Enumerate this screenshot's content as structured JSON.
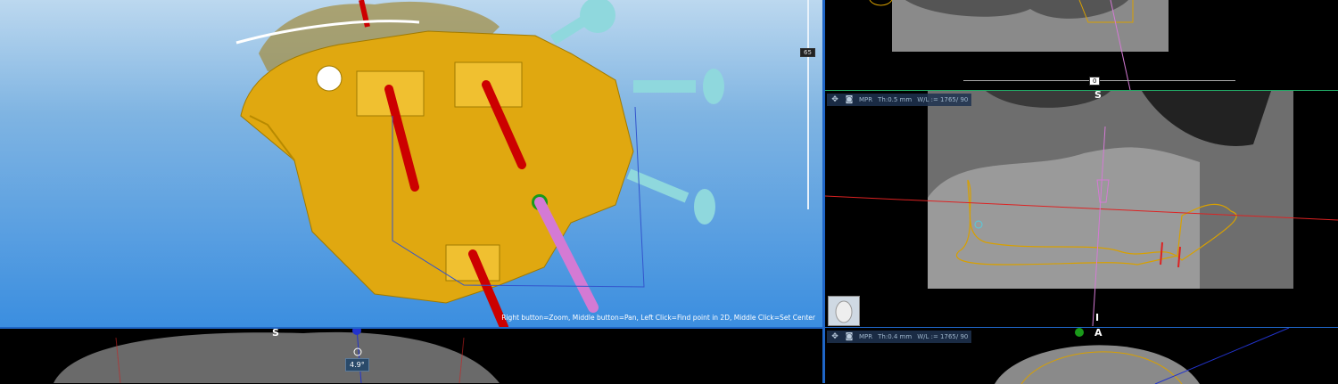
{
  "view3d": {
    "help_text": "Right button=Zoom, Middle button=Pan, Left Click=Find point in 2D, Middle Click=Set Center",
    "slider_value": "65"
  },
  "top_right": {
    "slider_value": "0"
  },
  "sagittal": {
    "mode": "MPR",
    "thickness": "Th:0.5 mm",
    "window_level": "W/L := 1765/ 90",
    "dir_top": "S",
    "dir_bottom": "I"
  },
  "axial": {
    "mode": "MPR",
    "thickness": "Th:0.4 mm",
    "window_level": "W/L := 1765/ 90",
    "dir_top": "A"
  },
  "coronal": {
    "dir_top": "S",
    "angle": "4.9°"
  },
  "colors": {
    "divider": "#1f66c7",
    "guide": "#d8a000",
    "implant": "#cc0000",
    "bone": "#e0a810"
  }
}
